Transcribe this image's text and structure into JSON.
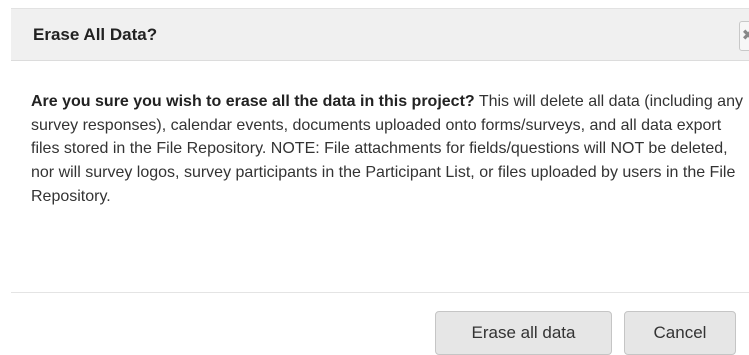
{
  "dialog": {
    "title": "Erase All Data?",
    "close_glyph": "✖",
    "body_bold": "Are you sure you wish to erase all the data in this project?",
    "body_text": " This will delete all data (including any survey responses), calendar events, documents uploaded onto forms/surveys, and all data export files stored in the File Repository. NOTE: File attachments for fields/questions will NOT be deleted, nor will survey logos, survey participants in the Participant List, or files uploaded by users in the File Repository.",
    "buttons": {
      "erase_label": "Erase all data",
      "cancel_label": "Cancel"
    }
  },
  "icons": {
    "close": "close-icon"
  }
}
